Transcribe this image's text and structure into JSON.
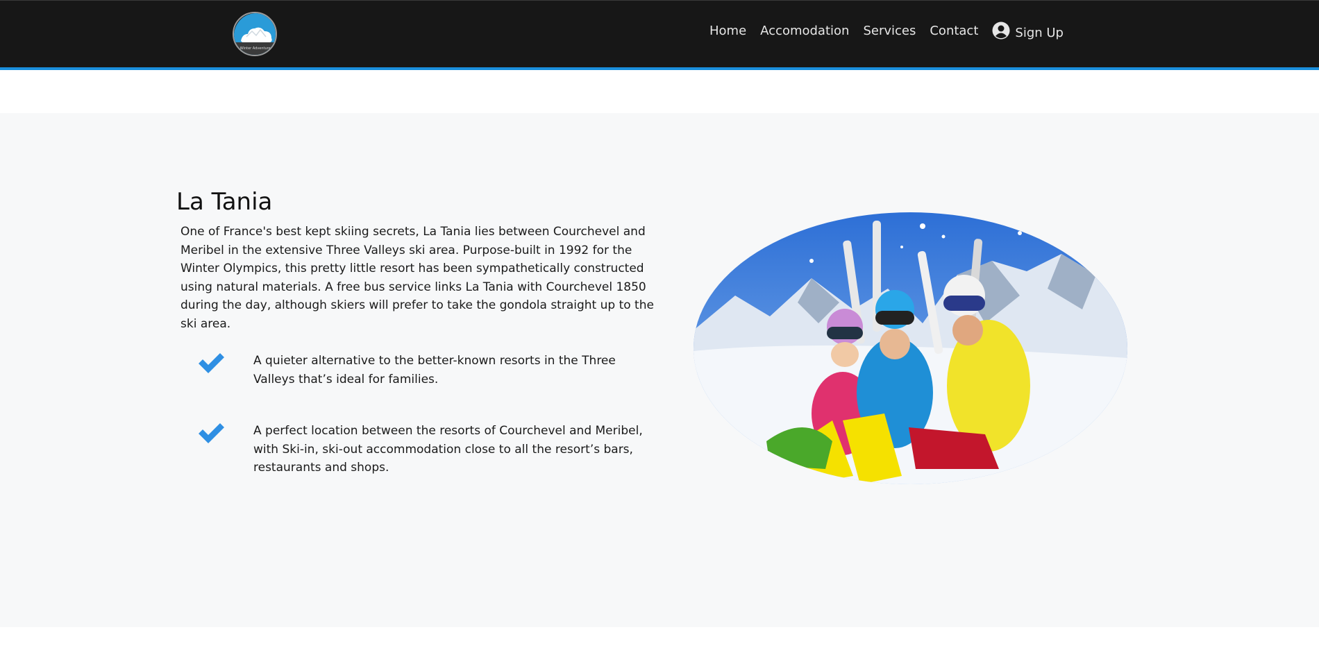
{
  "nav": {
    "logo_alt": "Winter Adventures",
    "links": [
      {
        "label": "Home"
      },
      {
        "label": "Accomodation"
      },
      {
        "label": "Services"
      },
      {
        "label": "Contact"
      }
    ],
    "signup_label": "Sign Up",
    "accent_color": "#1a8fdc",
    "background": "#171717"
  },
  "main": {
    "title": "La Tania",
    "intro": "One of France's best kept skiing secrets, La Tania lies between Courchevel and Meribel in the extensive Three Valleys ski area. Purpose-built in 1992 for the Winter Olympics, this pretty little resort has been sympathetically constructed using natural materials. A free bus service links La Tania with Courchevel 1850 during the day, although skiers will prefer to take the gondola straight up to the ski area.",
    "features": [
      {
        "icon": "checkmark-icon",
        "text": "A quieter alternative to the better-known resorts in the Three Valleys that’s ideal for families."
      },
      {
        "icon": "checkmark-icon",
        "text": "A perfect location between the resorts of Courchevel and Meribel, with Ski-in, ski-out accommodation close to all the resort’s bars, restaurants and shops."
      }
    ],
    "check_color": "#2f8fe3",
    "photo_alt": "Family of skiers sitting in the snow"
  }
}
